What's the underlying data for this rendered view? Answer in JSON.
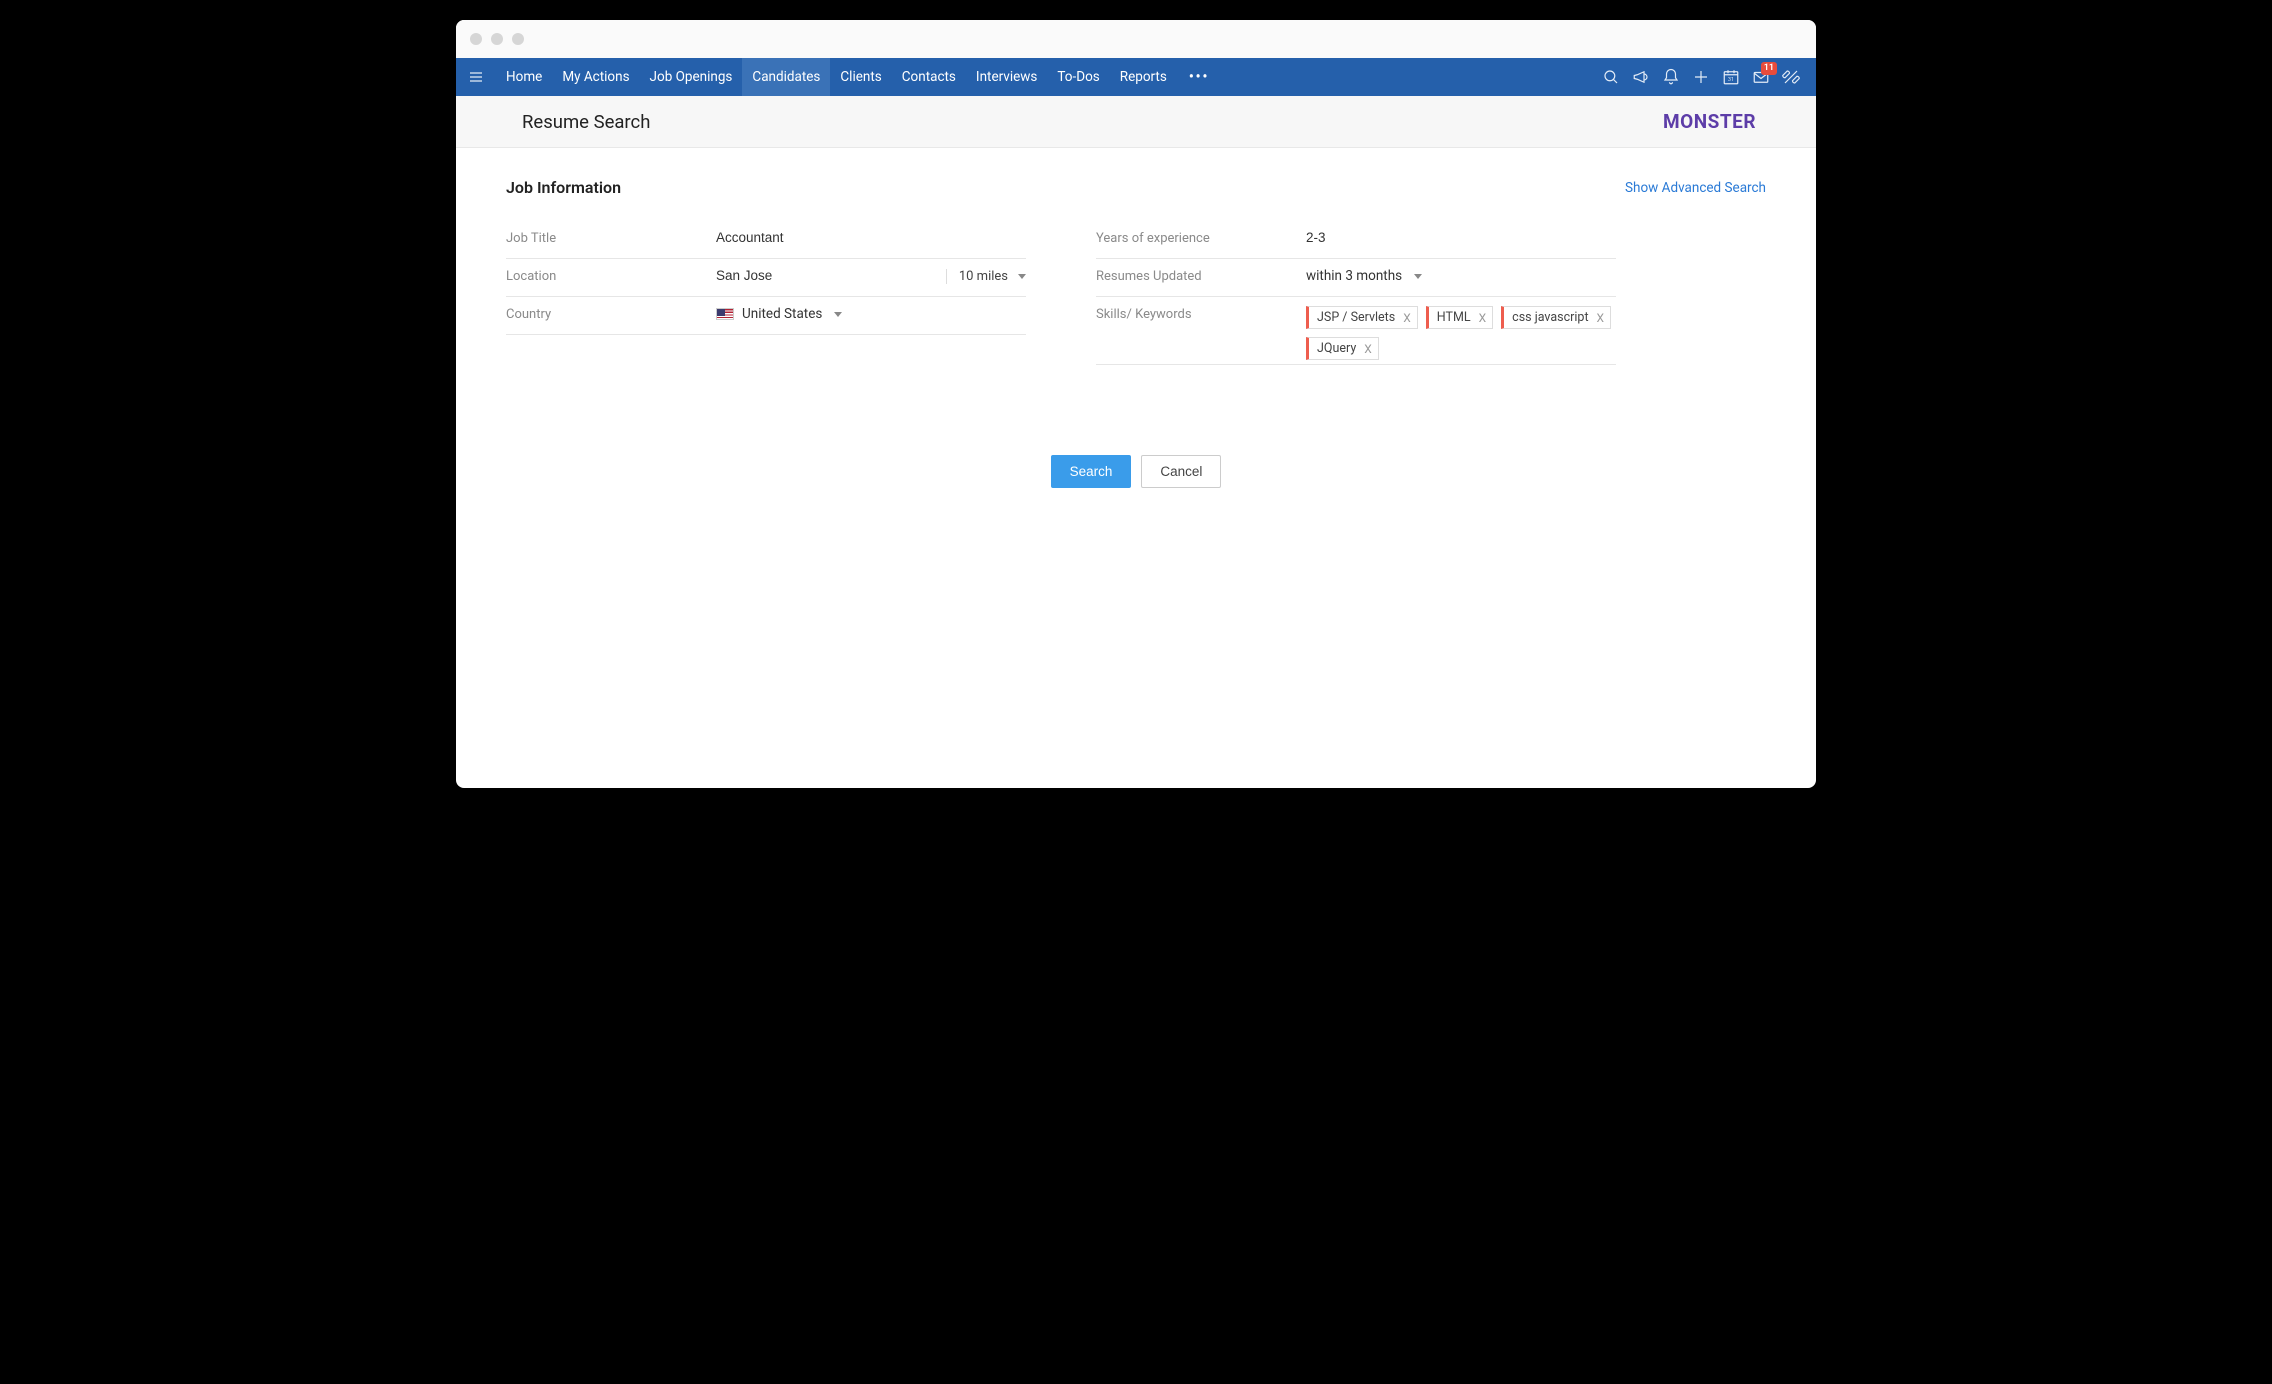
{
  "nav": {
    "items": [
      "Home",
      "My Actions",
      "Job Openings",
      "Candidates",
      "Clients",
      "Contacts",
      "Interviews",
      "To-Dos",
      "Reports"
    ],
    "active_index": 3,
    "mail_badge": "11"
  },
  "subheader": {
    "title": "Resume Search",
    "brand": "MonsteR"
  },
  "form": {
    "section_title": "Job Information",
    "advanced_link": "Show Advanced Search",
    "labels": {
      "job_title": "Job Title",
      "location": "Location",
      "country": "Country",
      "experience": "Years of experience",
      "updated": "Resumes Updated",
      "skills": "Skills/ Keywords"
    },
    "values": {
      "job_title": "Accountant",
      "location": "San Jose",
      "radius": "10 miles",
      "country": "United States",
      "experience": "2-3",
      "updated": "within 3 months"
    },
    "skills": [
      "JSP / Servlets",
      "HTML",
      "css javascript",
      "JQuery"
    ]
  },
  "buttons": {
    "search": "Search",
    "cancel": "Cancel"
  }
}
